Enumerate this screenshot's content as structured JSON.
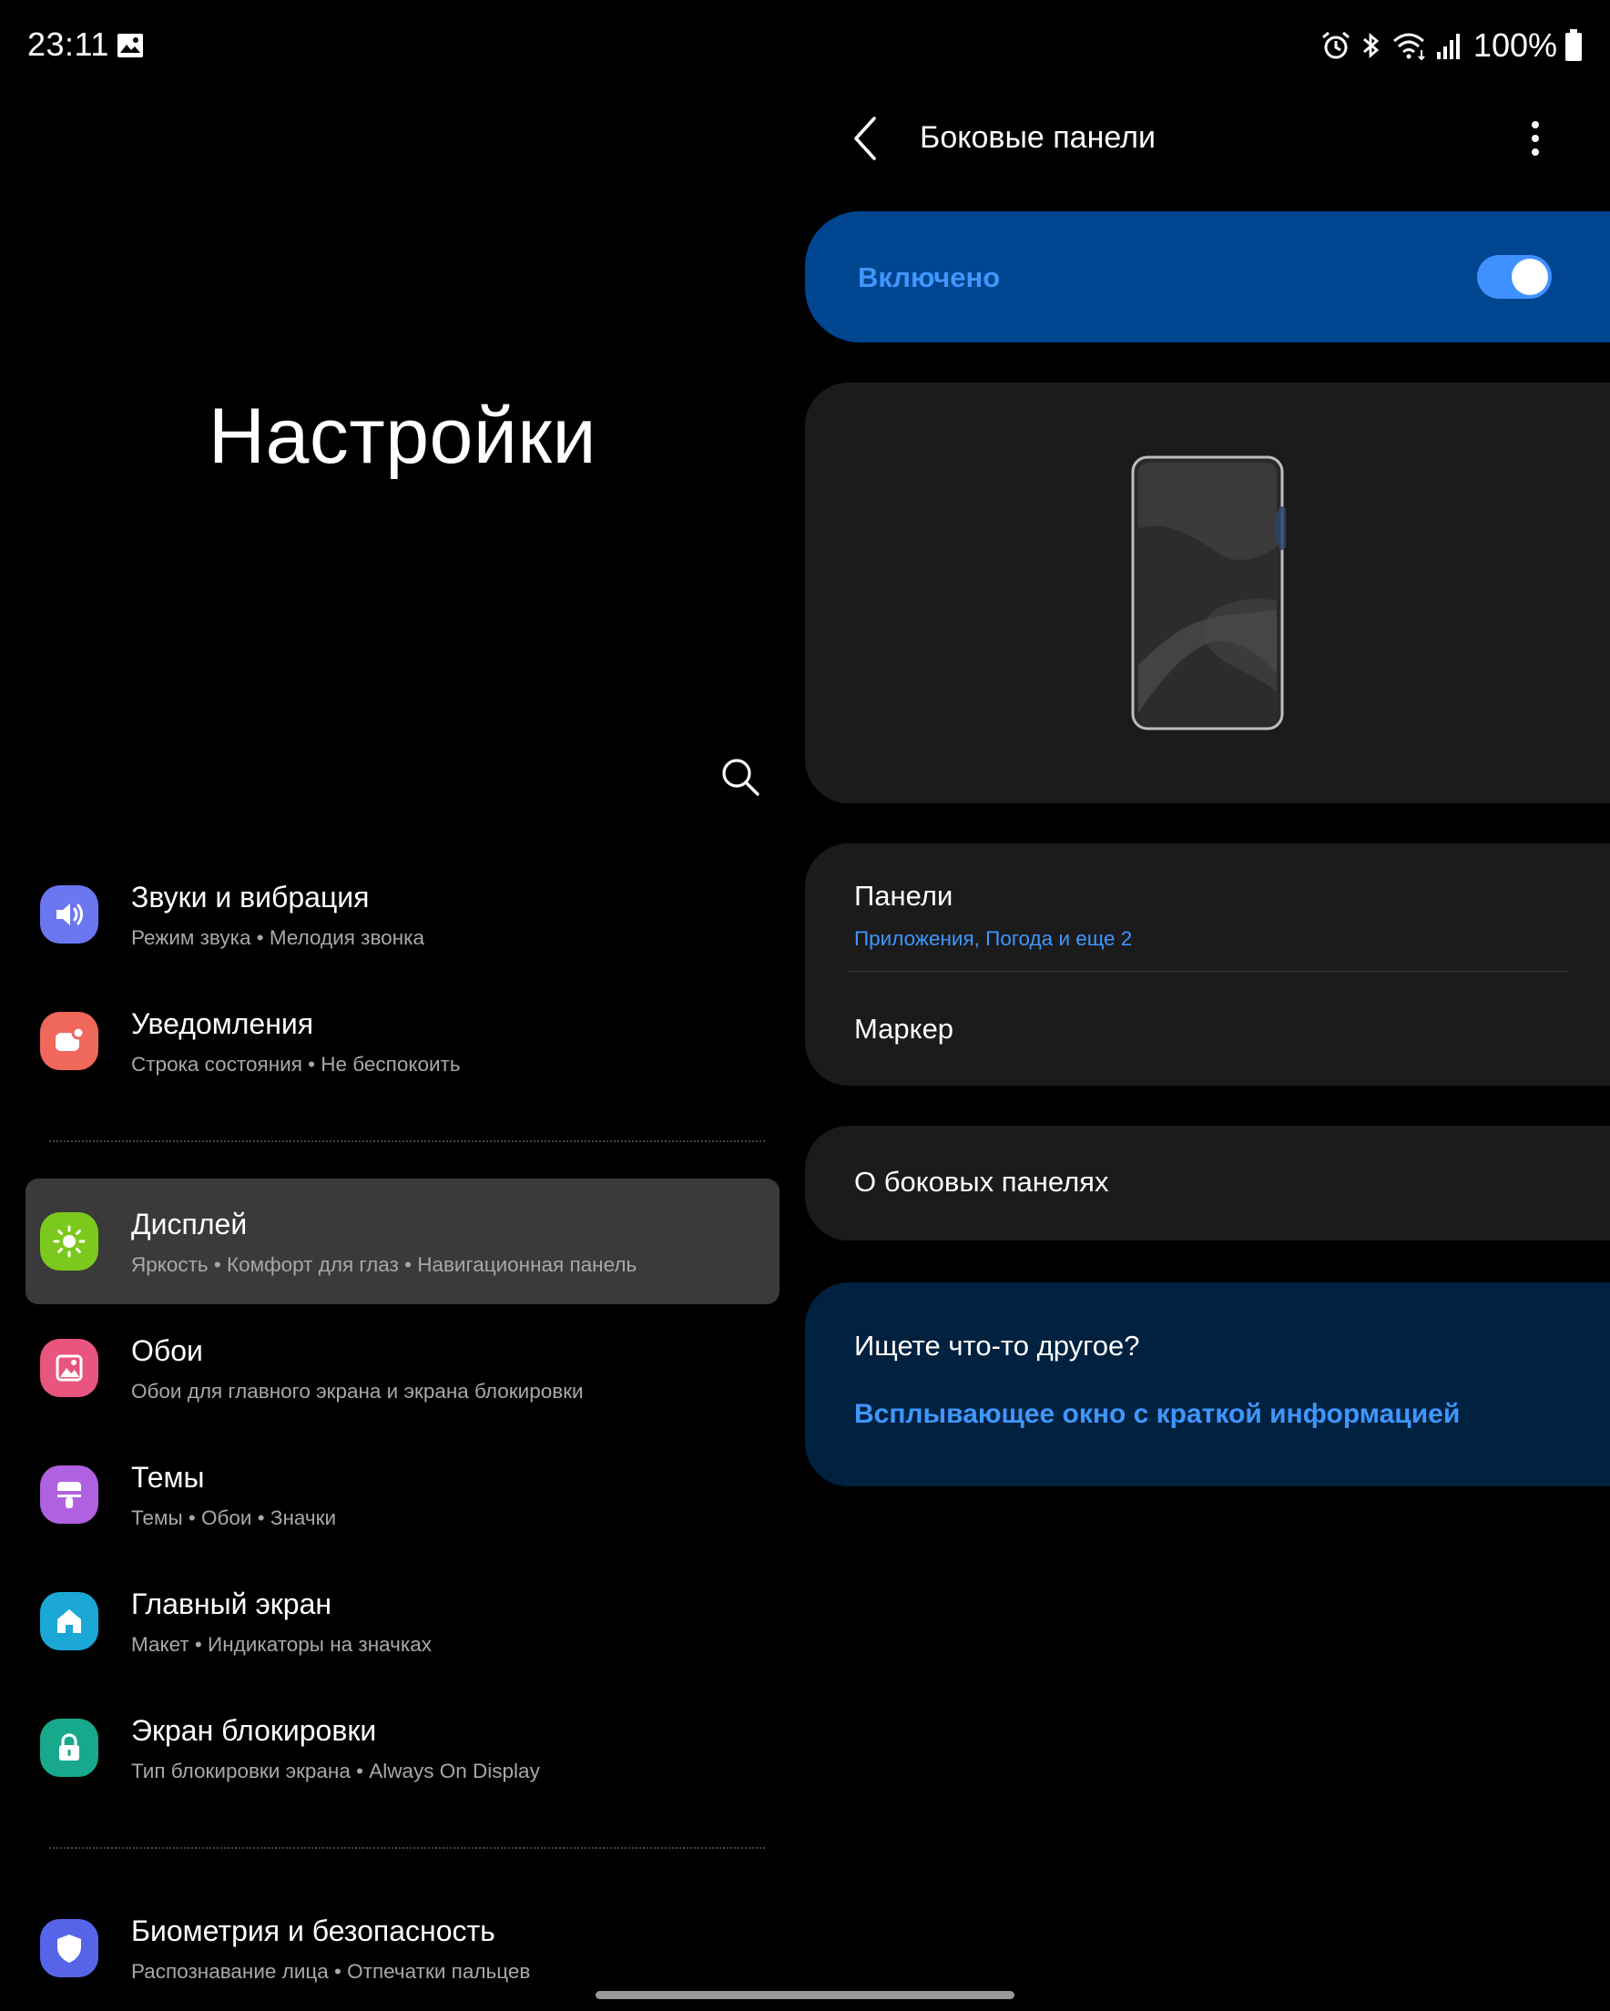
{
  "status_bar": {
    "time": "23:11",
    "battery": "100%",
    "icons": [
      "gallery-icon",
      "alarm-icon",
      "bluetooth-icon",
      "wifi-icon",
      "signal-icon",
      "battery-icon"
    ]
  },
  "left_pane": {
    "title": "Настройки",
    "search_icon": "search-icon",
    "menu": [
      {
        "title": "Звуки и вибрация",
        "subtitle": "Режим звука  •  Мелодия звонка",
        "icon": "volume-icon",
        "color": "#6b77f0"
      },
      {
        "title": "Уведомления",
        "subtitle": "Строка состояния  •  Не беспокоить",
        "icon": "notification-icon",
        "color": "#f0675c"
      },
      {
        "title": "Дисплей",
        "subtitle": "Яркость  •  Комфорт для глаз  •  Навигационная панель",
        "icon": "brightness-icon",
        "color": "#7cc91d",
        "selected": true
      },
      {
        "title": "Обои",
        "subtitle": "Обои для главного экрана и экрана блокировки",
        "icon": "wallpaper-icon",
        "color": "#e8557f"
      },
      {
        "title": "Темы",
        "subtitle": "Темы  •  Обои  •  Значки",
        "icon": "theme-brush-icon",
        "color": "#b061e0"
      },
      {
        "title": "Главный экран",
        "subtitle": "Макет  •  Индикаторы на значках",
        "icon": "home-icon",
        "color": "#1ba8d6"
      },
      {
        "title": "Экран блокировки",
        "subtitle": "Тип блокировки экрана  •  Always On Display",
        "icon": "lock-icon",
        "color": "#18a98c"
      },
      {
        "title": "Биометрия и безопасность",
        "subtitle": "Распознавание лица  •  Отпечатки пальцев",
        "icon": "shield-icon",
        "color": "#5665e8"
      }
    ]
  },
  "right_pane": {
    "header": {
      "title": "Боковые панели",
      "back_icon": "back-arrow-icon",
      "more_icon": "more-vertical-icon"
    },
    "switch": {
      "label": "Включено",
      "on": true
    },
    "preview_icon": "phone-edge-preview-icon",
    "list": [
      {
        "title": "Панели",
        "subtitle": "Приложения, Погода и еще 2"
      },
      {
        "title": "Маркер"
      }
    ],
    "about": {
      "title": "О боковых панелях"
    },
    "suggest": {
      "title": "Ищете что-то другое?",
      "link": "Всплывающее окно с краткой информацией"
    }
  },
  "colors": {
    "background": "#000000",
    "card": "#1b1b1b",
    "accent": "#3f96ff",
    "switch_card": "#00458f",
    "suggest_card": "#00213f"
  }
}
